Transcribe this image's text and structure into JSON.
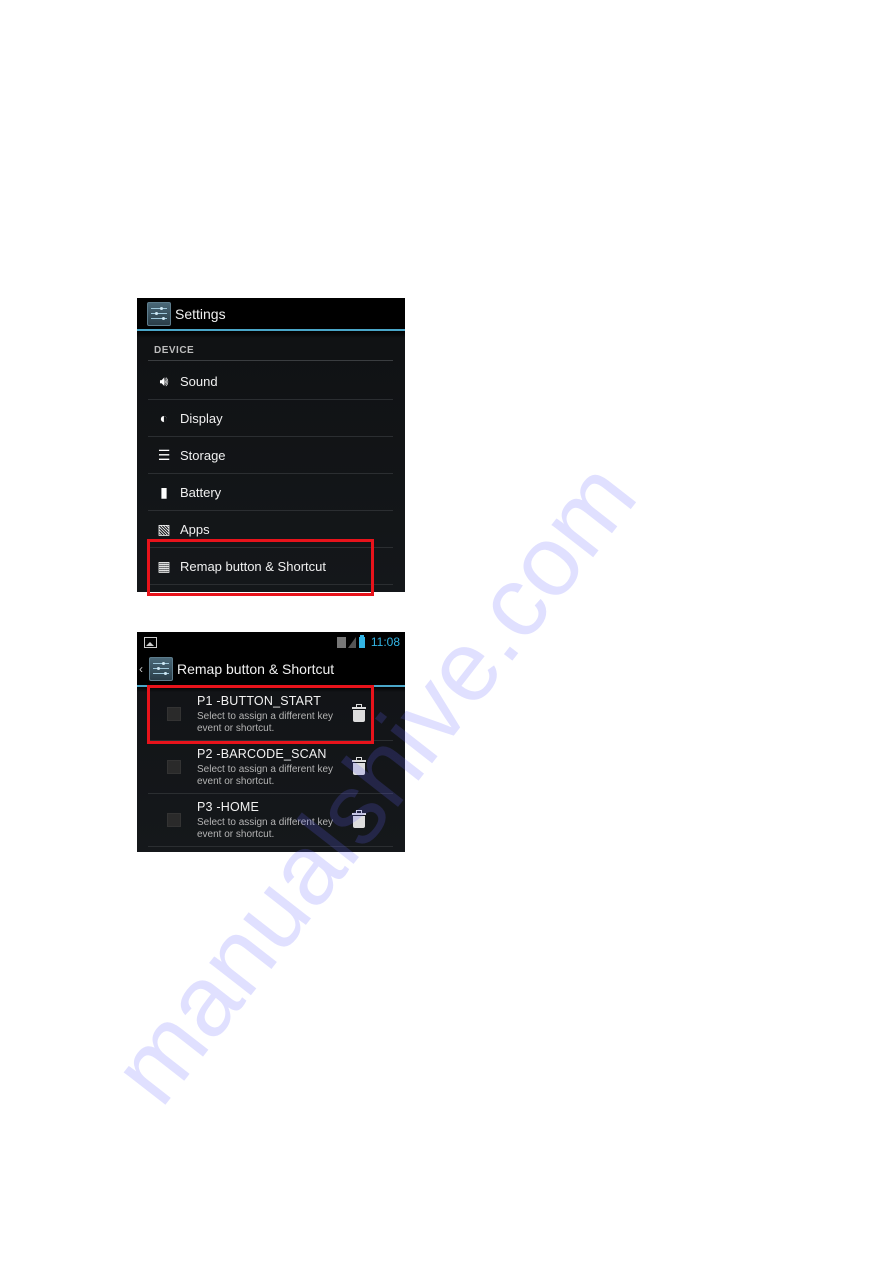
{
  "screenshot_1": {
    "action_bar": {
      "title": "Settings",
      "icon": "settings-sliders-icon"
    },
    "section_header": "DEVICE",
    "items": [
      {
        "label": "Sound",
        "icon": "speaker-icon"
      },
      {
        "label": "Display",
        "icon": "brightness-icon"
      },
      {
        "label": "Storage",
        "icon": "storage-icon"
      },
      {
        "label": "Battery",
        "icon": "battery-icon"
      },
      {
        "label": "Apps",
        "icon": "apps-icon"
      },
      {
        "label": "Remap button & Shortcut",
        "icon": "grid-icon",
        "highlighted": true
      }
    ]
  },
  "screenshot_2": {
    "status_bar": {
      "time": "11:08",
      "icons": [
        "image-icon",
        "sim-icon",
        "signal-icon",
        "battery-icon"
      ]
    },
    "action_bar": {
      "title": "Remap button & Shortcut",
      "back_icon": "back-chevron-icon",
      "icon": "settings-sliders-icon"
    },
    "rows": [
      {
        "name": "P1 -BUTTON_START",
        "summary": "Select to assign a different key event or shortcut.",
        "checked": false,
        "highlighted": true
      },
      {
        "name": "P2 -BARCODE_SCAN",
        "summary": "Select to assign a different key event or shortcut.",
        "checked": false,
        "highlighted": false
      },
      {
        "name": "P3 -HOME",
        "summary": "Select to assign a different key event or shortcut.",
        "checked": false,
        "highlighted": false
      }
    ]
  },
  "highlight_color": "#e8131b",
  "accent_color": "#33b5e5",
  "watermark": "manualshive.com"
}
